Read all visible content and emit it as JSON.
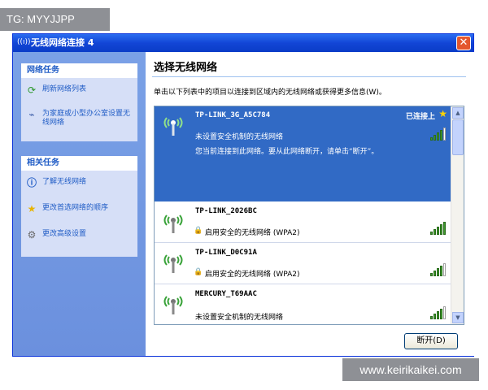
{
  "watermark_top": "TG: MYYJJPP",
  "watermark_bottom": "www.keirikaikei.com",
  "window": {
    "title": "无线网络连接 4",
    "close_glyph": "✕"
  },
  "sidebar": {
    "network_tasks": {
      "header": "网络任务",
      "items": [
        {
          "label": "刷新网络列表",
          "icon": "refresh-icon"
        },
        {
          "label": "为家庭或小型办公室设置无线网络",
          "icon": "wireless-setup-icon"
        }
      ]
    },
    "related_tasks": {
      "header": "相关任务",
      "items": [
        {
          "label": "了解无线网络",
          "icon": "info-icon"
        },
        {
          "label": "更改首选网络的顺序",
          "icon": "star-icon"
        },
        {
          "label": "更改高级设置",
          "icon": "settings-icon"
        }
      ]
    }
  },
  "main": {
    "heading": "选择无线网络",
    "instruction": "单击以下列表中的项目以连接到区域内的无线网络或获得更多信息(W)。",
    "networks": [
      {
        "ssid": "TP-LINK_3G_A5C784",
        "status": "已连接上",
        "line1": "未设置安全机制的无线网络",
        "line2": "您当前连接到此网络。要从此网络断开，请单击“断开”。",
        "signal_level": 4,
        "signal_max": 5
      },
      {
        "ssid": "TP-LINK_2026BC",
        "security": "启用安全的无线网络 (WPA2)",
        "signal_level": 5,
        "signal_max": 5
      },
      {
        "ssid": "TP-LINK_D0C91A",
        "security": "启用安全的无线网络 (WPA2)",
        "signal_level": 4,
        "signal_max": 5
      },
      {
        "ssid": "MERCURY_T69AAC",
        "line1": "未设置安全机制的无线网络",
        "signal_level": 4,
        "signal_max": 5
      }
    ],
    "disconnect_button": "断开(D)"
  }
}
